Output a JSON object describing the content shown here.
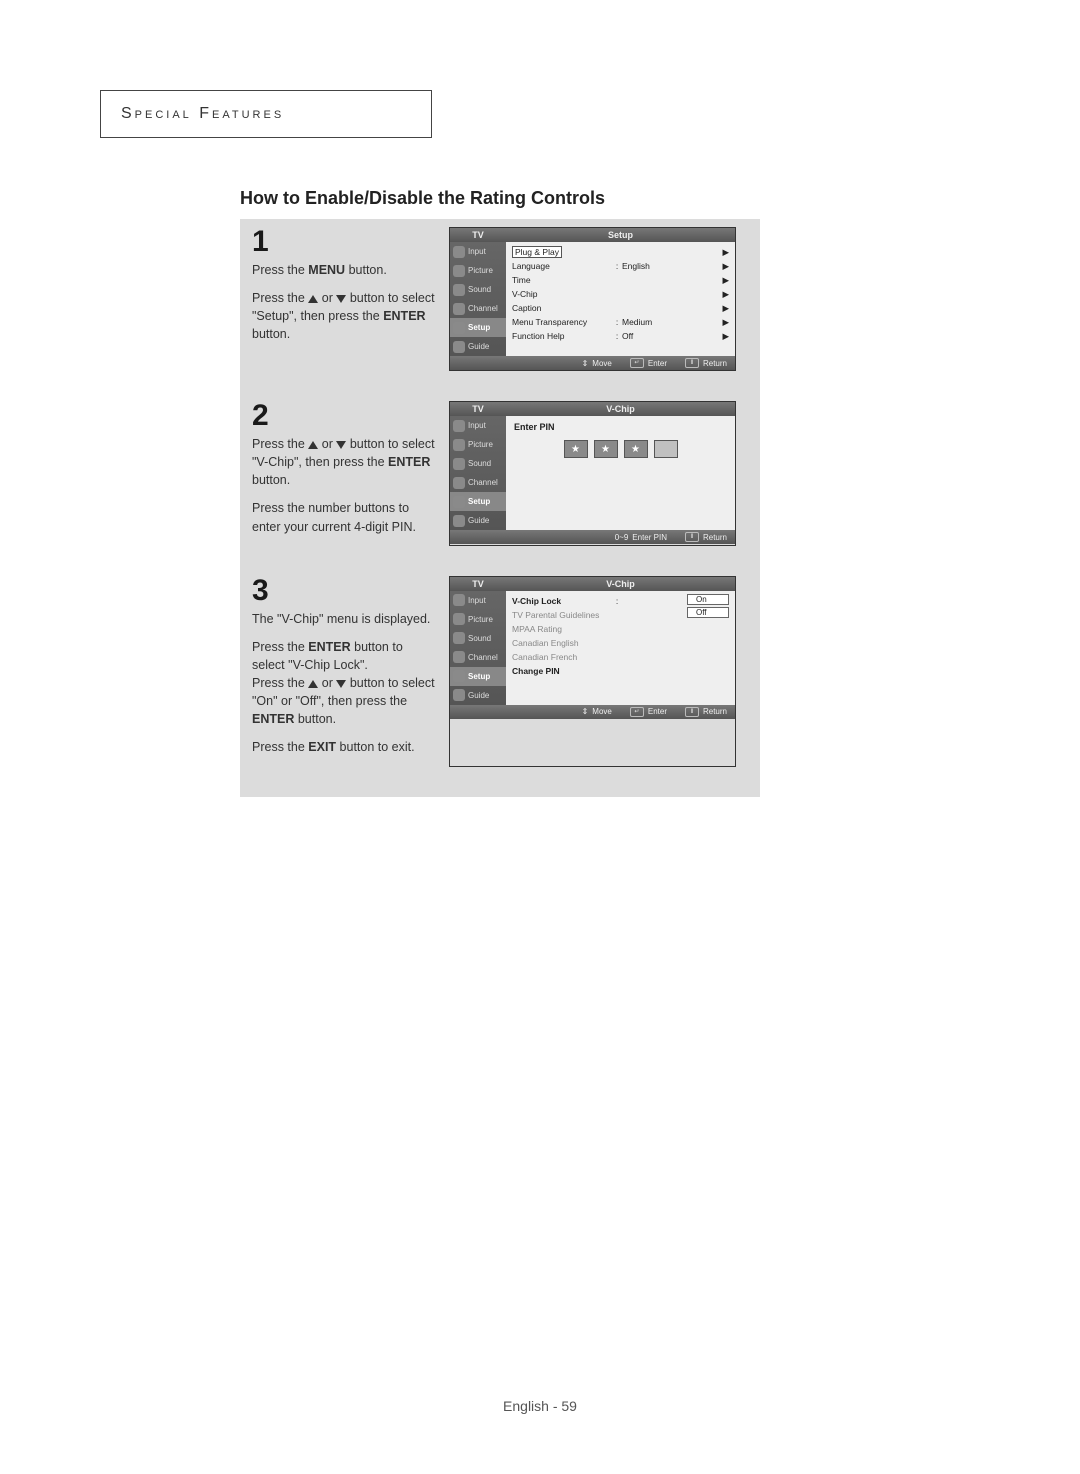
{
  "chapter": "Special Features",
  "section_title": "How to Enable/Disable the Rating Controls",
  "footer": "English - 59",
  "steps": {
    "s1": {
      "num": "1",
      "p1_a": "Press the ",
      "p1_b": "MENU",
      "p1_c": " button.",
      "p2_a": "Press the ",
      "p2_b": " or ",
      "p2_c": " button to select \"Setup\", then press the ",
      "p2_d": "ENTER",
      "p2_e": " button."
    },
    "s2": {
      "num": "2",
      "p1_a": "Press the ",
      "p1_b": " or ",
      "p1_c": " button to select \"V-Chip\", then press the ",
      "p1_d": "ENTER",
      "p1_e": " button.",
      "p2": "Press the number buttons to enter your current 4-digit PIN."
    },
    "s3": {
      "num": "3",
      "p1": "The \"V-Chip\" menu is displayed.",
      "p2_a": "Press the ",
      "p2_b": "ENTER",
      "p2_c": " button to select \"V-Chip Lock\".",
      "p3_a": "Press the ",
      "p3_b": " or ",
      "p3_c": " button to select \"On\" or \"Off\", then press the ",
      "p3_d": "ENTER",
      "p3_e": " button.",
      "p4_a": "Press the ",
      "p4_b": "EXIT",
      "p4_c": " button to exit."
    }
  },
  "osd_common": {
    "tv": "TV",
    "side": [
      "Input",
      "Picture",
      "Sound",
      "Channel",
      "Setup",
      "Guide"
    ],
    "footer": {
      "move": "Move",
      "enter": "Enter",
      "return": "Return",
      "enterpin": "Enter PIN",
      "num": "0~9"
    }
  },
  "osd1": {
    "title": "Setup",
    "rows": [
      {
        "label": "Plug & Play",
        "val": "",
        "arrow": "▶",
        "boxed": true
      },
      {
        "label": "Language",
        "val": "English",
        "arrow": "▶"
      },
      {
        "label": "Time",
        "val": "",
        "arrow": "▶"
      },
      {
        "label": "V-Chip",
        "val": "",
        "arrow": "▶"
      },
      {
        "label": "Caption",
        "val": "",
        "arrow": "▶"
      },
      {
        "label": "Menu Transparency",
        "val": "Medium",
        "arrow": "▶"
      },
      {
        "label": "Function Help",
        "val": "Off",
        "arrow": "▶"
      }
    ]
  },
  "osd2": {
    "title": "V-Chip",
    "pin_label": "Enter PIN",
    "pin": [
      "★",
      "★",
      "★",
      ""
    ]
  },
  "osd3": {
    "title": "V-Chip",
    "rows": [
      {
        "label": "V-Chip Lock",
        "grey": false,
        "bold": true
      },
      {
        "label": "TV Parental Guidelines",
        "grey": true
      },
      {
        "label": "MPAA Rating",
        "grey": true
      },
      {
        "label": "Canadian English",
        "grey": true
      },
      {
        "label": "Canadian French",
        "grey": true
      },
      {
        "label": "Change PIN",
        "grey": false,
        "bold": true
      }
    ],
    "options": [
      "On",
      "Off"
    ]
  }
}
